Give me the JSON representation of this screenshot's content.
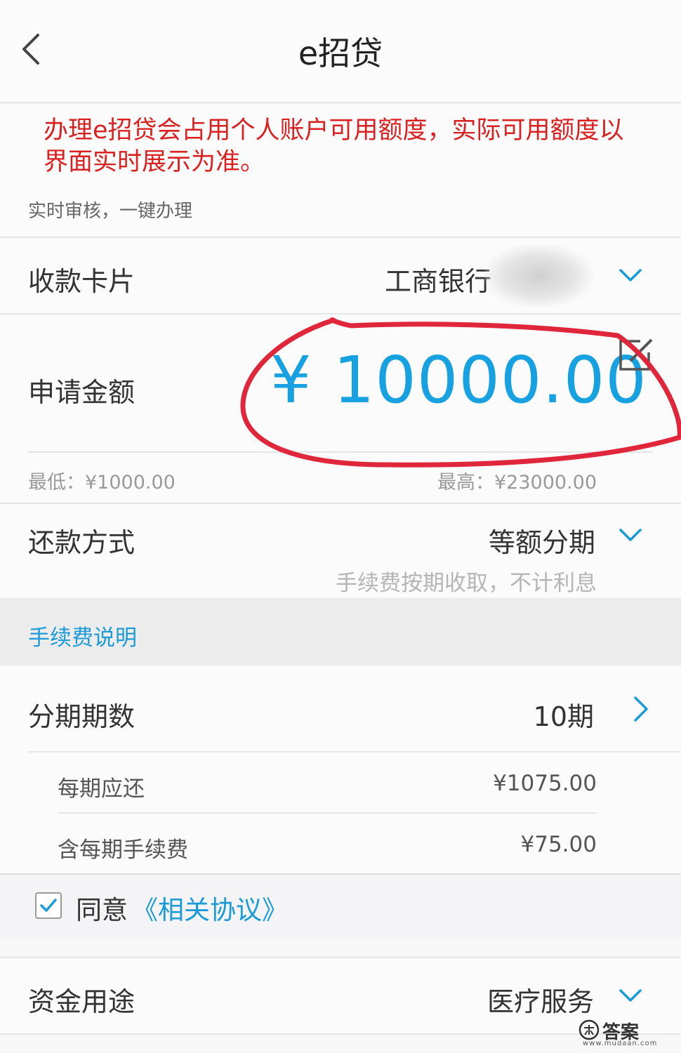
{
  "nav": {
    "title": "e招贷"
  },
  "notice": {
    "text": "办理e招贷会占用个人账户可用额度，实际可用额度以界面实时展示为准。",
    "sub": "实时审核，一键办理"
  },
  "card": {
    "label": "收款卡片",
    "value": "工商银行"
  },
  "amount": {
    "label": "申请金额",
    "value": "¥ 10000.00",
    "min": "最低：¥1000.00",
    "max": "最高：¥23000.00"
  },
  "repay": {
    "label": "还款方式",
    "value": "等额分期",
    "note": "手续费按期收取，不计利息"
  },
  "fee_link": "手续费说明",
  "period": {
    "label": "分期期数",
    "value": "10期",
    "per_label": "每期应还",
    "per_value": "¥1075.00",
    "fee_label": "含每期手续费",
    "fee_value": "¥75.00"
  },
  "agree": {
    "text": "同意",
    "link": "《相关协议》",
    "checked": true
  },
  "usage": {
    "label": "资金用途",
    "value": "医疗服务"
  },
  "watermark": {
    "text": "答案",
    "sub": "www.mudaan.com"
  },
  "colors": {
    "accent": "#18a1e0",
    "warning": "#d92121",
    "annotation": "#e0263a"
  }
}
